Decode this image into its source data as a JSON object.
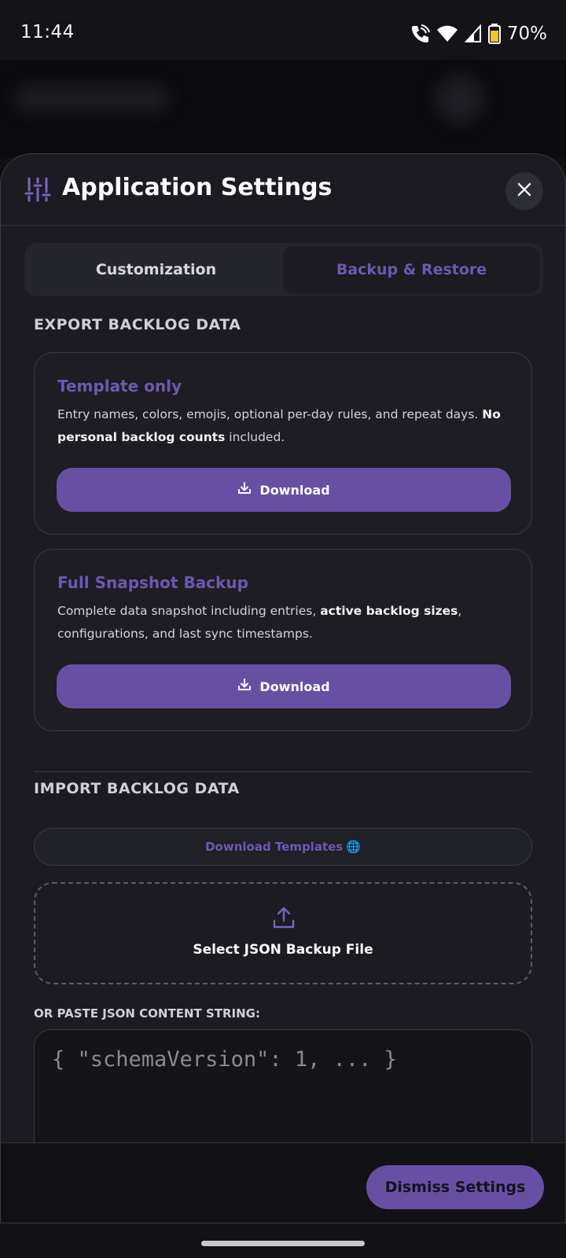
{
  "status_bar": {
    "time": "11:44",
    "battery": "70%",
    "icons": [
      "wifi-call-icon",
      "wifi-icon",
      "signal-icon",
      "battery-icon"
    ]
  },
  "sheet": {
    "title": "Application Settings",
    "header_icon": "sliders-icon",
    "close_icon": "close-icon"
  },
  "tabs": [
    {
      "label": "Customization",
      "active": false
    },
    {
      "label": "Backup & Restore",
      "active": true
    }
  ],
  "export": {
    "heading": "EXPORT BACKLOG DATA",
    "template_card": {
      "title": "Template only",
      "desc_text": "Entry names, colors, emojis, optional per-day rules, and repeat days. ",
      "desc_bold": "No personal backlog counts",
      "desc_tail": " included.",
      "button_label": "Download"
    },
    "snapshot_card": {
      "title": "Full Snapshot Backup",
      "desc_text": "Complete data snapshot including entries, ",
      "desc_bold": "active backlog sizes",
      "desc_tail": ", configurations, and last sync timestamps.",
      "button_label": "Download"
    }
  },
  "import": {
    "heading": "IMPORT BACKLOG DATA",
    "templates_button": "Download Templates",
    "templates_emoji": "🌐",
    "select_file_label": "Select JSON Backup File",
    "paste_label": "OR PASTE JSON CONTENT STRING:",
    "paste_placeholder": "{ \"schemaVersion\": 1, ... }"
  },
  "footer": {
    "dismiss_label": "Dismiss Settings"
  },
  "colors": {
    "accent": "#6750a4",
    "accent_text": "#6e58b0",
    "sheet_bg": "#1b1b21",
    "page_bg": "#101014"
  }
}
